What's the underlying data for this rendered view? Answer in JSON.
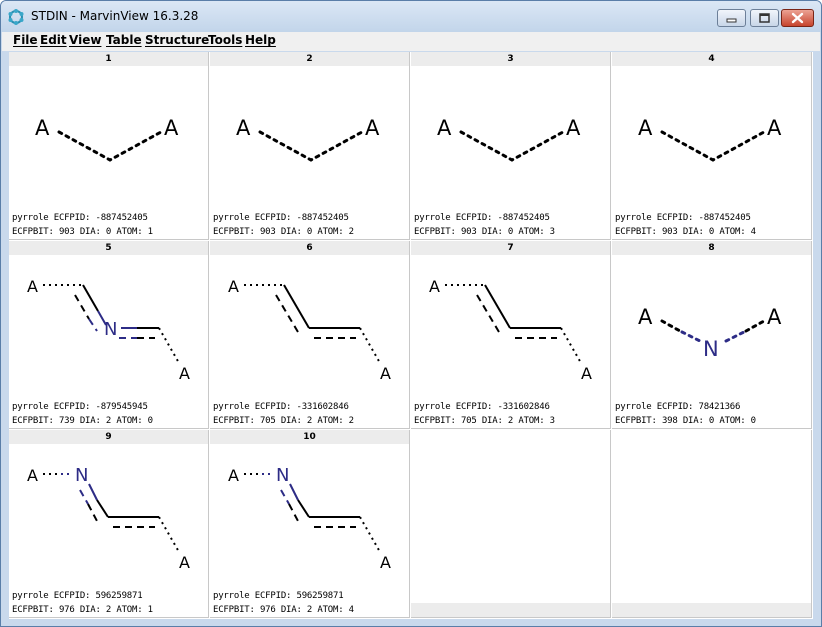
{
  "window": {
    "title": "STDIN - MarvinView 16.3.28",
    "app_icon": "marvin-molecule-icon",
    "controls": [
      "minimize-icon",
      "maximize-icon",
      "close-icon"
    ]
  },
  "menu": [
    "File",
    "Edit",
    "View",
    "Table",
    "Structure",
    "Tools",
    "Help"
  ],
  "colors": {
    "nitrogen": "#2d2c86",
    "cell_header": "#ececec",
    "bond": "#000000"
  },
  "cells": [
    {
      "index": "1",
      "line1": "pyrrole ECFPID: -887452405",
      "line2": "ECFPBIT: 903 DIA: 0 ATOM: 1"
    },
    {
      "index": "2",
      "line1": "pyrrole ECFPID: -887452405",
      "line2": "ECFPBIT: 903 DIA: 0 ATOM: 2"
    },
    {
      "index": "3",
      "line1": "pyrrole ECFPID: -887452405",
      "line2": "ECFPBIT: 903 DIA: 0 ATOM: 3"
    },
    {
      "index": "4",
      "line1": "pyrrole ECFPID: -887452405",
      "line2": "ECFPBIT: 903 DIA: 0 ATOM: 4"
    },
    {
      "index": "5",
      "line1": "pyrrole ECFPID: -879545945",
      "line2": "ECFPBIT: 739 DIA: 2 ATOM: 0"
    },
    {
      "index": "6",
      "line1": "pyrrole ECFPID: -331602846",
      "line2": "ECFPBIT: 705 DIA: 2 ATOM: 2"
    },
    {
      "index": "7",
      "line1": "pyrrole ECFPID: -331602846",
      "line2": "ECFPBIT: 705 DIA: 2 ATOM: 3"
    },
    {
      "index": "8",
      "line1": "pyrrole ECFPID: 78421366",
      "line2": "ECFPBIT: 398 DIA: 0 ATOM: 0"
    },
    {
      "index": "9",
      "line1": "pyrrole ECFPID: 596259871",
      "line2": "ECFPBIT: 976 DIA: 2 ATOM: 1"
    },
    {
      "index": "10",
      "line1": "pyrrole ECFPID: 596259871",
      "line2": "ECFPBIT: 976 DIA: 2 ATOM: 4"
    }
  ],
  "atoms": {
    "any": "A",
    "nitrogen": "N"
  }
}
